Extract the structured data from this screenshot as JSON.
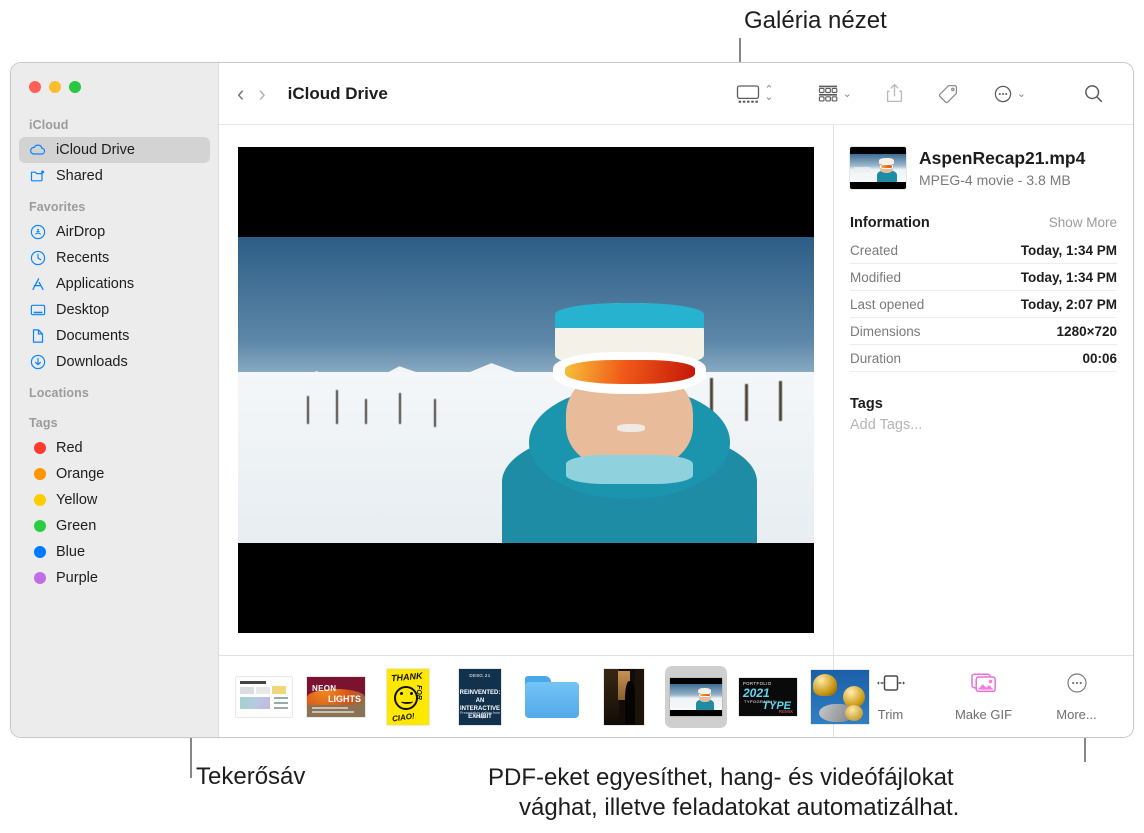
{
  "callouts": {
    "gallery_view": "Galéria nézet",
    "scrubber": "Tekerősáv",
    "quick_actions_line1": "PDF-eket egyesíthet, hang- és videófájlokat",
    "quick_actions_line2": "vághat, illetve feladatokat automatizálhat."
  },
  "window": {
    "traffic_lights": {
      "close": "close",
      "minimize": "minimize",
      "zoom": "zoom"
    }
  },
  "sidebar": {
    "sections": [
      {
        "title": "iCloud",
        "items": [
          {
            "label": "iCloud Drive",
            "icon": "cloud-icon",
            "selected": true
          },
          {
            "label": "Shared",
            "icon": "shared-folder-icon",
            "selected": false
          }
        ]
      },
      {
        "title": "Favorites",
        "items": [
          {
            "label": "AirDrop",
            "icon": "airdrop-icon",
            "selected": false
          },
          {
            "label": "Recents",
            "icon": "clock-icon",
            "selected": false
          },
          {
            "label": "Applications",
            "icon": "applications-icon",
            "selected": false
          },
          {
            "label": "Desktop",
            "icon": "desktop-icon",
            "selected": false
          },
          {
            "label": "Documents",
            "icon": "document-icon",
            "selected": false
          },
          {
            "label": "Downloads",
            "icon": "downloads-icon",
            "selected": false
          }
        ]
      },
      {
        "title": "Locations",
        "items": []
      },
      {
        "title": "Tags",
        "items": [
          {
            "label": "Red",
            "icon": "tag-dot-icon",
            "color": "#ff3b30"
          },
          {
            "label": "Orange",
            "icon": "tag-dot-icon",
            "color": "#ff9500"
          },
          {
            "label": "Yellow",
            "icon": "tag-dot-icon",
            "color": "#ffcc00"
          },
          {
            "label": "Green",
            "icon": "tag-dot-icon",
            "color": "#28cd41"
          },
          {
            "label": "Blue",
            "icon": "tag-dot-icon",
            "color": "#007aff"
          },
          {
            "label": "Purple",
            "icon": "tag-dot-icon",
            "color": "#c06ee8"
          }
        ]
      }
    ]
  },
  "toolbar": {
    "back": "‹",
    "forward": "›",
    "path_title": "iCloud Drive",
    "buttons": [
      {
        "name": "gallery-view-button",
        "icon": "gallery-view-icon",
        "has_chevron": true
      },
      {
        "name": "group-by-button",
        "icon": "group-items-icon",
        "has_chevron": true
      },
      {
        "name": "share-button",
        "icon": "share-icon",
        "has_chevron": false
      },
      {
        "name": "tag-button",
        "icon": "tag-icon",
        "has_chevron": false
      },
      {
        "name": "more-actions-button",
        "icon": "ellipsis-circle-icon",
        "has_chevron": true
      },
      {
        "name": "search-button",
        "icon": "search-icon",
        "has_chevron": false
      }
    ]
  },
  "preview": {
    "alt": "Skier wearing teal jacket, white beanie and orange goggles on a snowy mountain"
  },
  "filmstrip": {
    "items": [
      {
        "name": "infographic-poster-thumbnail",
        "selected": false
      },
      {
        "name": "neon-lights-poster-thumbnail",
        "selected": false
      },
      {
        "name": "thank-you-yellow-poster-thumbnail",
        "selected": false
      },
      {
        "name": "design-exhibit-poster-thumbnail",
        "selected": false
      },
      {
        "name": "blue-folder-thumbnail",
        "selected": false
      },
      {
        "name": "silhouette-photo-thumbnail",
        "selected": false
      },
      {
        "name": "aspen-recap-video-thumbnail",
        "selected": true
      },
      {
        "name": "typography-2021-poster-thumbnail",
        "selected": false
      },
      {
        "name": "gold-abstract-render-thumbnail",
        "selected": false
      }
    ]
  },
  "inspector": {
    "file_name": "AspenRecap21.mp4",
    "file_meta": "MPEG-4 movie - 3.8 MB",
    "information": {
      "title": "Information",
      "action": "Show More",
      "rows": [
        {
          "key": "Created",
          "value": "Today, 1:34 PM"
        },
        {
          "key": "Modified",
          "value": "Today, 1:34 PM"
        },
        {
          "key": "Last opened",
          "value": "Today, 2:07 PM"
        },
        {
          "key": "Dimensions",
          "value": "1280×720"
        },
        {
          "key": "Duration",
          "value": "00:06"
        }
      ]
    },
    "tags": {
      "title": "Tags",
      "placeholder": "Add Tags..."
    },
    "quick_actions": [
      {
        "label": "Trim",
        "icon": "trim-icon"
      },
      {
        "label": "Make GIF",
        "icon": "make-gif-icon"
      },
      {
        "label": "More...",
        "icon": "ellipsis-circle-icon"
      }
    ]
  },
  "colors": {
    "accent_blue": "#007aff",
    "sidebar_bg": "#ececec",
    "selection_gray": "#d3d3d3",
    "gif_pink": "#f25fd0"
  }
}
